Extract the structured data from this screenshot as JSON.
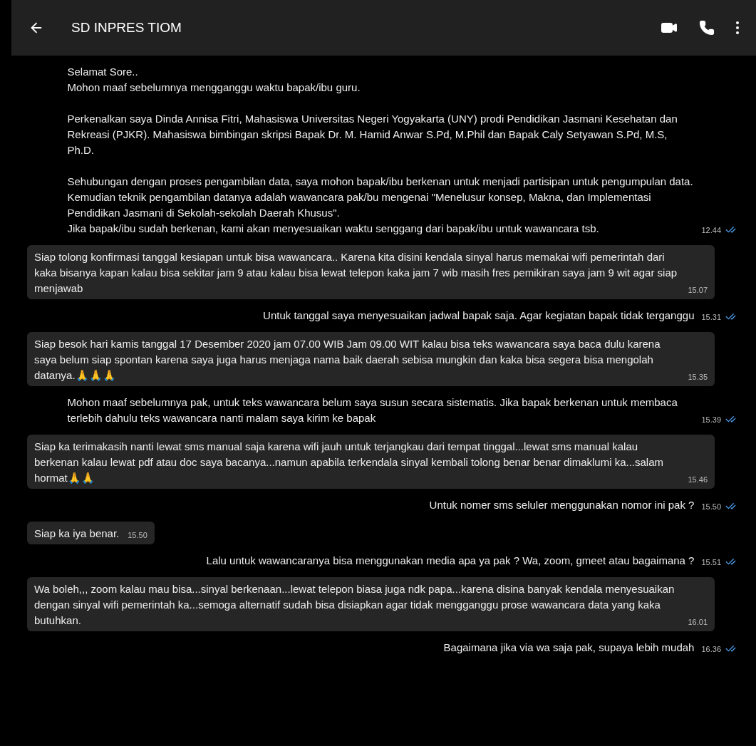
{
  "header": {
    "title": "SD INPRES TIOM"
  },
  "messages": [
    {
      "kind": "sent",
      "text": "Selamat Sore..\nMohon maaf sebelumnya mengganggu waktu bapak/ibu guru.\n\nPerkenalkan saya Dinda Annisa Fitri, Mahasiswa Universitas Negeri Yogyakarta (UNY) prodi Pendidikan Jasmani Kesehatan dan Rekreasi (PJKR). Mahasiswa bimbingan skripsi Bapak Dr. M. Hamid Anwar S.Pd, M.Phil dan Bapak Caly Setyawan S.Pd, M.S, Ph.D.\n\nSehubungan dengan proses pengambilan data, saya mohon bapak/ibu berkenan untuk menjadi partisipan untuk pengumpulan data. Kemudian teknik pengambilan datanya adalah wawancara pak/bu mengenai \"Menelusur konsep, Makna, dan Implementasi Pendidikan  Jasmani di Sekolah-sekolah Daerah Khusus\".\nJika bapak/ibu sudah berkenan, kami akan menyesuaikan waktu senggang dari bapak/ibu untuk wawancara tsb.",
      "time": "12.44"
    },
    {
      "kind": "received",
      "text": "Siap tolong konfirmasi tanggal kesiapan untuk bisa wawancara.. Karena kita disini kendala sinyal harus memakai wifi pemerintah dari kaka bisanya kapan kalau bisa sekitar jam 9 atau kalau bisa lewat telepon kaka jam 7 wib masih fres pemikiran saya jam 9 wit agar siap menjawab",
      "time": "15.07"
    },
    {
      "kind": "sent",
      "text": "Untuk tanggal saya menyesuaikan jadwal bapak saja. Agar kegiatan bapak tidak terganggu",
      "time": "15.31"
    },
    {
      "kind": "received",
      "text": "Siap besok hari kamis tanggal 17 Desember 2020 jam 07.00 WIB Jam 09.00 WIT kalau bisa teks wawancara saya baca dulu karena saya belum siap spontan karena saya juga harus menjaga nama baik daerah sebisa mungkin dan kaka bisa segera bisa mengolah datanya.🙏🙏🙏",
      "time": "15.35"
    },
    {
      "kind": "sent",
      "text": "Mohon maaf sebelumnya pak, untuk teks wawancara belum saya susun secara sistematis. Jika bapak berkenan untuk membaca terlebih dahulu teks wawancara nanti malam saya kirim ke bapak",
      "time": "15.39"
    },
    {
      "kind": "received",
      "text": "Siap ka terimakasih nanti lewat sms manual saja karena wifi jauh untuk terjangkau dari tempat tinggal...lewat sms manual kalau berkenan kalau lewat pdf atau doc saya bacanya...namun apabila terkendala sinyal kembali tolong benar benar dimaklumi ka...salam hormat🙏🙏",
      "time": "15.46"
    },
    {
      "kind": "sent",
      "text": "Untuk nomer sms seluler menggunakan nomor ini pak ?",
      "time": "15.50"
    },
    {
      "kind": "received",
      "text": "Siap ka iya benar.",
      "time": "15.50"
    },
    {
      "kind": "sent",
      "text": "Lalu untuk wawancaranya bisa menggunakan media apa ya pak ? Wa, zoom, gmeet atau bagaimana ?",
      "time": "15.51"
    },
    {
      "kind": "received",
      "text": "Wa boleh,,, zoom kalau mau bisa...sinyal berkenaan...lewat telepon biasa juga ndk papa...karena disina banyak kendala menyesuaikan dengan sinyal wifi pemerintah ka...semoga alternatif sudah bisa disiapkan agar tidak mengganggu prose wawancara data yang kaka butuhkan.",
      "time": "16.01"
    },
    {
      "kind": "sent",
      "text": "Bagaimana jika via wa saja pak, supaya lebih mudah",
      "time": "16.36"
    }
  ]
}
